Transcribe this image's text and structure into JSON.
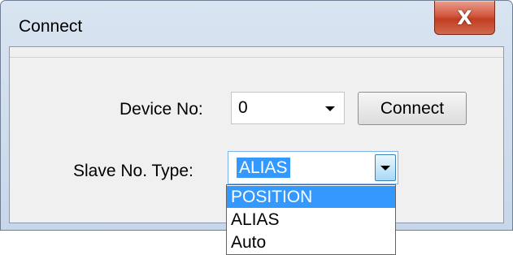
{
  "window": {
    "title": "Connect",
    "close_glyph": "X"
  },
  "device": {
    "label": "Device No:",
    "value": "0"
  },
  "connect_button": {
    "label": "Connect"
  },
  "slave_type": {
    "label": "Slave No. Type:",
    "value": "ALIAS",
    "options": [
      "POSITION",
      "ALIAS",
      "Auto"
    ],
    "highlighted_option": "POSITION"
  },
  "colors": {
    "selection": "#3399ff",
    "close_button": "#c23d21",
    "titlebar": "#d9e4f1"
  }
}
